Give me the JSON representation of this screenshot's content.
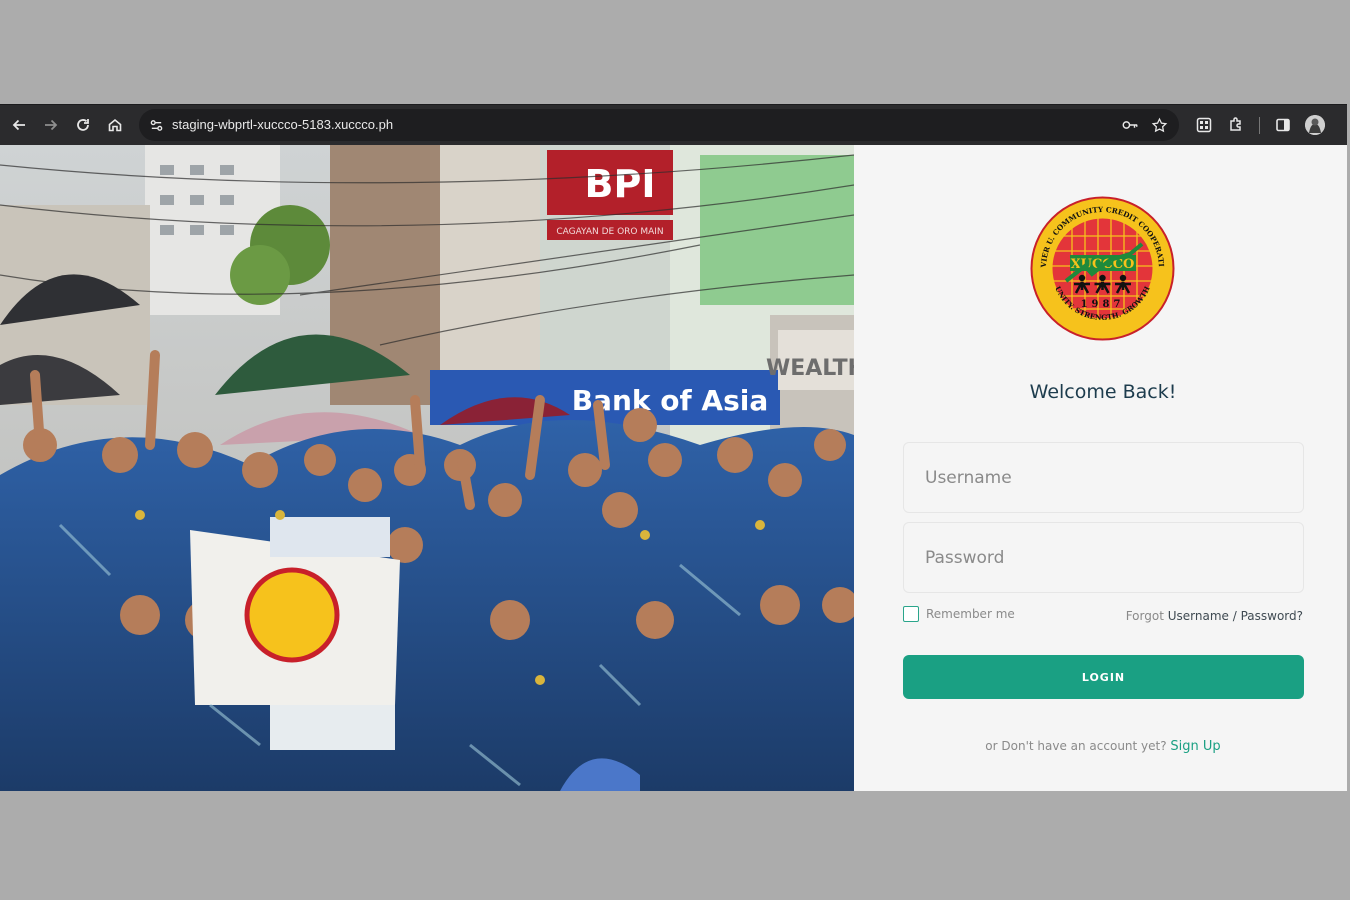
{
  "browser": {
    "url": "staging-wbprtl-xuccco-5183.xuccco.ph",
    "icons": [
      "back-icon",
      "forward-icon",
      "reload-icon",
      "home-icon",
      "site-info-icon",
      "password-key-icon",
      "bookmark-star-icon",
      "qr-code-icon",
      "extensions-icon",
      "side-panel-icon",
      "profile-avatar"
    ]
  },
  "hero": {
    "sign_bank": "BPI",
    "sign_bank_sub": "CAGAYAN DE ORO MAIN",
    "sign_banner": "Bank of Asia",
    "sign_wealth": "WEALTH"
  },
  "logo": {
    "name": "XUCCCO",
    "year": "1987",
    "ring_top": "XAVIER U. COMMUNITY CREDIT COOPERATIVE",
    "ring_bottom": "UNITY. STRENGTH. GROWTH"
  },
  "login": {
    "welcome": "Welcome Back!",
    "username_placeholder": "Username",
    "password_placeholder": "Password",
    "remember_label": "Remember me",
    "forgot_prefix": "Forgot ",
    "forgot_link": "Username / Password?",
    "login_label": "LOGIN",
    "signup_prefix": "or Don't have an account yet? ",
    "signup_link": "Sign Up"
  },
  "colors": {
    "accent": "#1aa083",
    "chrome_dark": "#2b2b2d",
    "panel_bg": "#f5f5f5",
    "welcome_text": "#1d3c4d",
    "logo_red": "#c8202a",
    "logo_yellow": "#f6c21c"
  }
}
